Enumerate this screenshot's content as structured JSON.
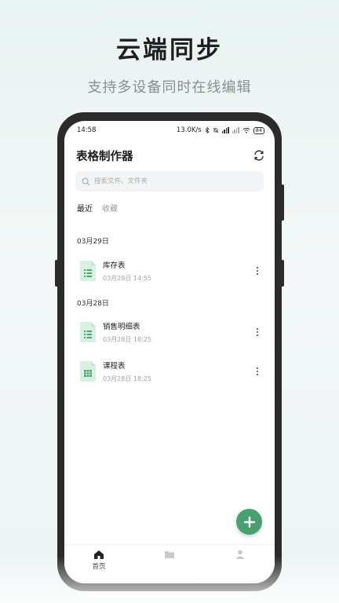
{
  "promo": {
    "title": "云端同步",
    "subtitle": "支持多设备同时在线编辑"
  },
  "statusbar": {
    "time": "14:58",
    "net_speed": "13.0K/s",
    "battery": "84"
  },
  "app": {
    "title": "表格制作器",
    "refresh_icon": "refresh-icon"
  },
  "search": {
    "placeholder": "搜索文件、文件夹"
  },
  "tabs": [
    {
      "label": "最近",
      "active": true
    },
    {
      "label": "收藏",
      "active": false
    }
  ],
  "groups": [
    {
      "date": "03月29日",
      "files": [
        {
          "name": "库存表",
          "time": "03月29日 14:55",
          "icon": "list-sheet-icon"
        }
      ]
    },
    {
      "date": "03月28日",
      "files": [
        {
          "name": "销售明细表",
          "time": "03月28日 18:25",
          "icon": "list-sheet-icon"
        },
        {
          "name": "课程表",
          "time": "03月28日 18:25",
          "icon": "grid-sheet-icon"
        }
      ]
    }
  ],
  "fab": {
    "icon": "plus-icon"
  },
  "bottomnav": [
    {
      "label": "首页",
      "icon": "home-icon",
      "active": true
    }
  ],
  "colors": {
    "accent": "#46a070",
    "file_icon_bg": "#d9f1e3",
    "file_icon_fg": "#4aa56f"
  }
}
